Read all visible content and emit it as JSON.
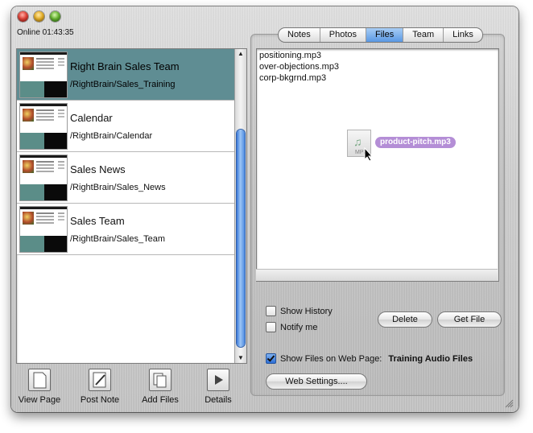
{
  "window": {
    "status_text": "Online 01:43:35"
  },
  "list": {
    "items": [
      {
        "title": "Right Brain Sales Team",
        "path": "/RightBrain/Sales_Training",
        "selected": true
      },
      {
        "title": "Calendar",
        "path": "/RightBrain/Calendar",
        "selected": false
      },
      {
        "title": "Sales News",
        "path": "/RightBrain/Sales_News",
        "selected": false
      },
      {
        "title": "Sales Team",
        "path": "/RightBrain/Sales_Team",
        "selected": false
      }
    ]
  },
  "toolbar": {
    "view_page": "View Page",
    "post_note": "Post Note",
    "add_files": "Add Files",
    "details": "Details"
  },
  "tabs": [
    {
      "label": "Notes",
      "active": false
    },
    {
      "label": "Photos",
      "active": false
    },
    {
      "label": "Files",
      "active": true
    },
    {
      "label": "Team",
      "active": false
    },
    {
      "label": "Links",
      "active": false
    }
  ],
  "files": {
    "items": [
      "positioning.mp3",
      "over-objections.mp3",
      "corp-bkgrnd.mp3"
    ],
    "dragging": "product-pitch.mp3"
  },
  "options": {
    "show_history": "Show History",
    "show_history_checked": false,
    "notify_me": "Notify me",
    "notify_me_checked": false,
    "show_files_label": "Show Files on Web Page:",
    "show_files_checked": true,
    "show_files_value": "Training Audio Files"
  },
  "buttons": {
    "delete": "Delete",
    "get_file": "Get File",
    "web_settings": "Web Settings...."
  }
}
